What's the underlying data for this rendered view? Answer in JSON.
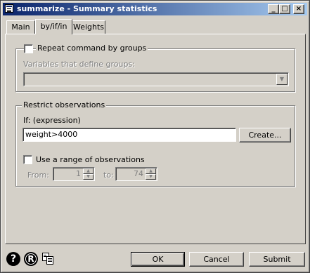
{
  "window": {
    "title": "summarize - Summary statistics",
    "minimize_glyph": "_",
    "maximize_glyph": "□",
    "close_glyph": "×"
  },
  "tabs": [
    {
      "label": "Main",
      "active": false
    },
    {
      "label": "by/if/in",
      "active": true
    },
    {
      "label": "Weights",
      "active": false
    }
  ],
  "by_group": {
    "checkbox_label": "Repeat command by groups",
    "checked": false,
    "variables_label": "Variables that define groups:",
    "variables_value": ""
  },
  "restrict": {
    "group_label": "Restrict observations",
    "if_label": "If: (expression)",
    "if_value": "weight>4000",
    "create_label": "Create...",
    "range_checkbox_label": "Use a range of observations",
    "range_checked": false,
    "from_label": "From:",
    "from_value": "1",
    "to_label": "to:",
    "to_value": "74"
  },
  "footer": {
    "help_icon_glyph": "?",
    "reset_icon_glyph": "R",
    "ok_label": "OK",
    "cancel_label": "Cancel",
    "submit_label": "Submit"
  },
  "icons": {
    "app": "stata-dialog-icon",
    "help": "help-icon",
    "reset": "reset-icon",
    "copy": "copy-command-icon"
  },
  "colors": {
    "titlebar_start": "#0a246a",
    "titlebar_end": "#a6caf0",
    "face": "#d4d0c8"
  }
}
